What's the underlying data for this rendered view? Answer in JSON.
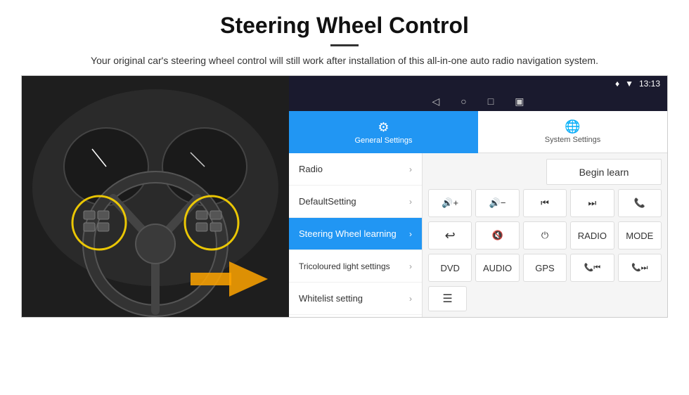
{
  "header": {
    "title": "Steering Wheel Control",
    "subtitle": "Your original car's steering wheel control will still work after installation of this all-in-one auto radio navigation system."
  },
  "status_bar": {
    "time": "13:13",
    "icons": [
      "♥",
      "▼",
      "●"
    ]
  },
  "nav_bar": {
    "back": "◁",
    "home": "○",
    "recents": "□",
    "cast": "▣"
  },
  "tabs": [
    {
      "id": "general",
      "label": "General Settings",
      "icon": "⚙",
      "active": true
    },
    {
      "id": "system",
      "label": "System Settings",
      "icon": "🌐",
      "active": false
    }
  ],
  "menu_items": [
    {
      "label": "Radio",
      "active": false
    },
    {
      "label": "DefaultSetting",
      "active": false
    },
    {
      "label": "Steering Wheel learning",
      "active": true
    },
    {
      "label": "Tricoloured light settings",
      "active": false
    },
    {
      "label": "Whitelist setting",
      "active": false
    }
  ],
  "right_panel": {
    "begin_learn_label": "Begin learn",
    "buttons_row1": [
      {
        "label": "🔊+",
        "name": "vol-up"
      },
      {
        "label": "🔊-",
        "name": "vol-down"
      },
      {
        "label": "⏮",
        "name": "prev-track"
      },
      {
        "label": "⏭",
        "name": "next-track"
      },
      {
        "label": "📞",
        "name": "call"
      }
    ],
    "buttons_row2": [
      {
        "label": "↩",
        "name": "hang-up"
      },
      {
        "label": "🔇",
        "name": "mute"
      },
      {
        "label": "⏻",
        "name": "power"
      },
      {
        "label": "RADIO",
        "name": "radio"
      },
      {
        "label": "MODE",
        "name": "mode"
      }
    ],
    "buttons_row3": [
      {
        "label": "DVD",
        "name": "dvd"
      },
      {
        "label": "AUDIO",
        "name": "audio"
      },
      {
        "label": "GPS",
        "name": "gps"
      },
      {
        "label": "📞⏮",
        "name": "tel-prev"
      },
      {
        "label": "📞⏭",
        "name": "tel-next"
      }
    ],
    "bottom_icon": "☰"
  }
}
